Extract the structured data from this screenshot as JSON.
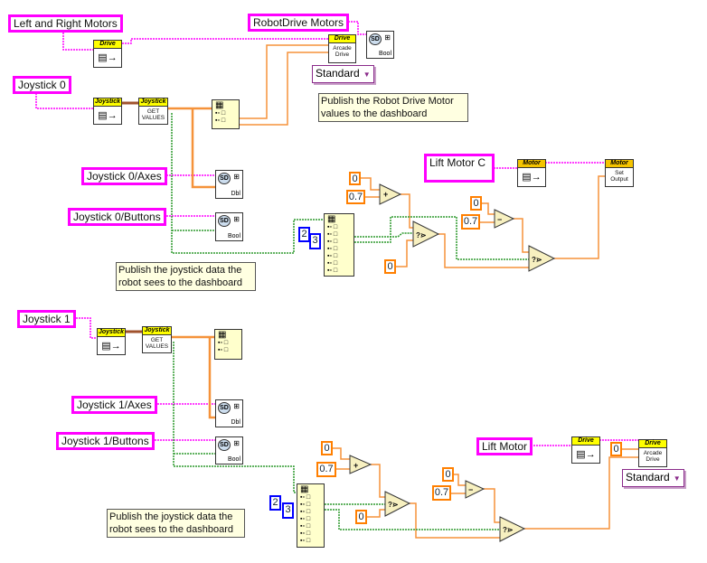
{
  "controls": {
    "left_right_motors": "Left and Right Motors",
    "robotdrive_motors": "RobotDrive Motors",
    "joystick0": "Joystick 0",
    "joystick0_axes": "Joystick 0/Axes",
    "joystick0_buttons": "Joystick 0/Buttons",
    "lift_motor_c": "Lift Motor C",
    "joystick1": "Joystick 1",
    "joystick1_axes": "Joystick 1/Axes",
    "joystick1_buttons": "Joystick 1/Buttons",
    "lift_motor": "Lift Motor"
  },
  "vis": {
    "drive": "Drive",
    "joystick": "Joystick",
    "motor": "Motor",
    "arcade_drive": "Arcade\nDrive",
    "get_values": "GET\nVALUES",
    "set_output": "Set\nOutput",
    "sd": "SD",
    "bool": "Bool",
    "dbl": "Dbl",
    "open_icon": "▤→"
  },
  "enums": {
    "standard": "Standard"
  },
  "constants": {
    "zero": "0",
    "point_seven": "0.7",
    "two": "2",
    "three": "3"
  },
  "comments": {
    "robot_drive": "Publish the Robot Drive Motor values to the dashboard",
    "joystick": "Publish the joystick data the robot sees to the dashboard"
  },
  "icons": {
    "add": "add-icon",
    "subtract": "subtract-icon",
    "select": "select-icon",
    "unbundle": "unbundle-icon",
    "index_array": "index-array-icon"
  },
  "colors": {
    "refnum_wire": "#ff00ff",
    "double_wire": "#f5923a",
    "bool_wire": "#2e9a2e",
    "vi_header": "#ffff00",
    "constant_border": "#ff7f00",
    "int_constant_border": "#0000ff",
    "comment_bg": "#ffffe1"
  }
}
